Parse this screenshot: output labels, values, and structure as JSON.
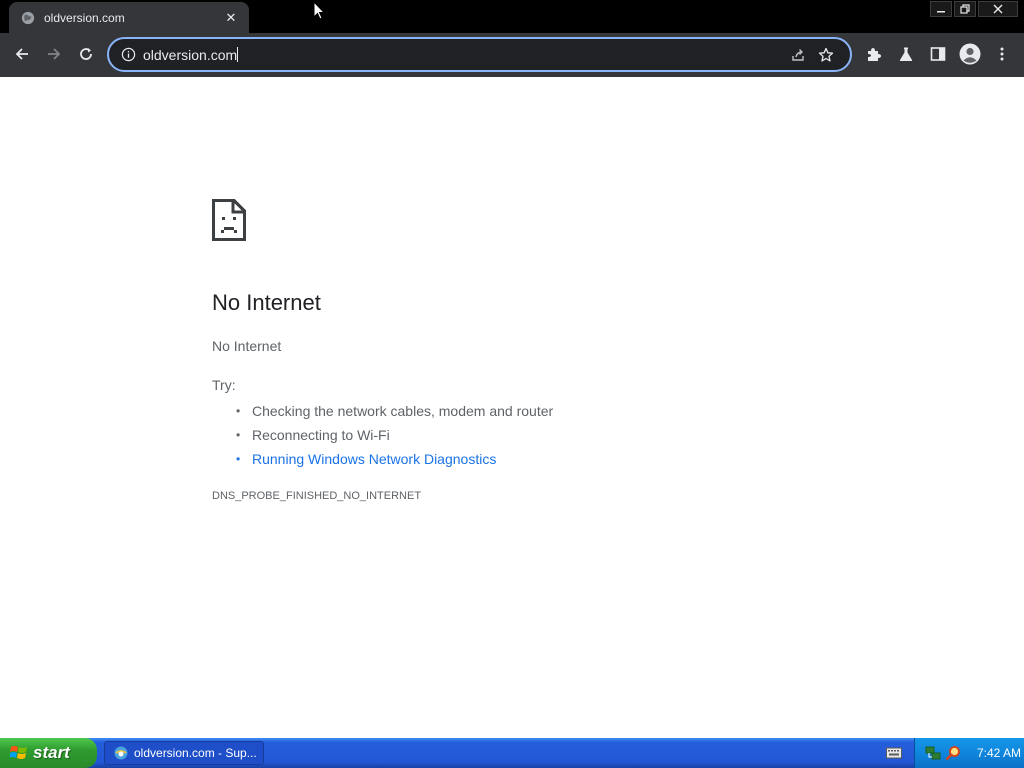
{
  "browser": {
    "tab_title": "oldversion.com",
    "url": "oldversion.com",
    "window_controls": [
      "minimize",
      "restore",
      "close"
    ]
  },
  "error_page": {
    "heading": "No Internet",
    "subheading": "No Internet",
    "try_label": "Try:",
    "suggestions": [
      "Checking the network cables, modem and router",
      "Reconnecting to Wi-Fi",
      "Running Windows Network Diagnostics"
    ],
    "error_code": "DNS_PROBE_FINISHED_NO_INTERNET"
  },
  "taskbar": {
    "start_label": "start",
    "task_item_label": "oldversion.com - Sup...",
    "clock": "7:42 AM"
  },
  "colors": {
    "link": "#1a73e8",
    "omnibox_focus": "#8ab4f8",
    "toolbar": "#35363a"
  }
}
